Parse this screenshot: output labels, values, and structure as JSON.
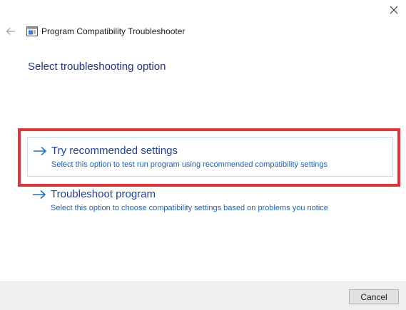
{
  "window": {
    "close_icon": "close-icon",
    "back_icon": "back-arrow-icon",
    "app_icon": "troubleshooter-app-icon",
    "title": "Program Compatibility Troubleshooter"
  },
  "page": {
    "heading": "Select troubleshooting option"
  },
  "options": [
    {
      "title": "Try recommended settings",
      "description": "Select this option to test run program using recommended compatibility settings",
      "icon": "arrow-right-icon",
      "selected": true
    },
    {
      "title": "Troubleshoot program",
      "description": "Select this option to choose compatibility settings based on problems you notice",
      "icon": "arrow-right-icon",
      "selected": false
    }
  ],
  "footer": {
    "cancel_label": "Cancel"
  },
  "colors": {
    "highlight": "#e53238",
    "heading": "#1e3287",
    "link": "#1e3f9e",
    "arrow": "#1e6fd0"
  }
}
